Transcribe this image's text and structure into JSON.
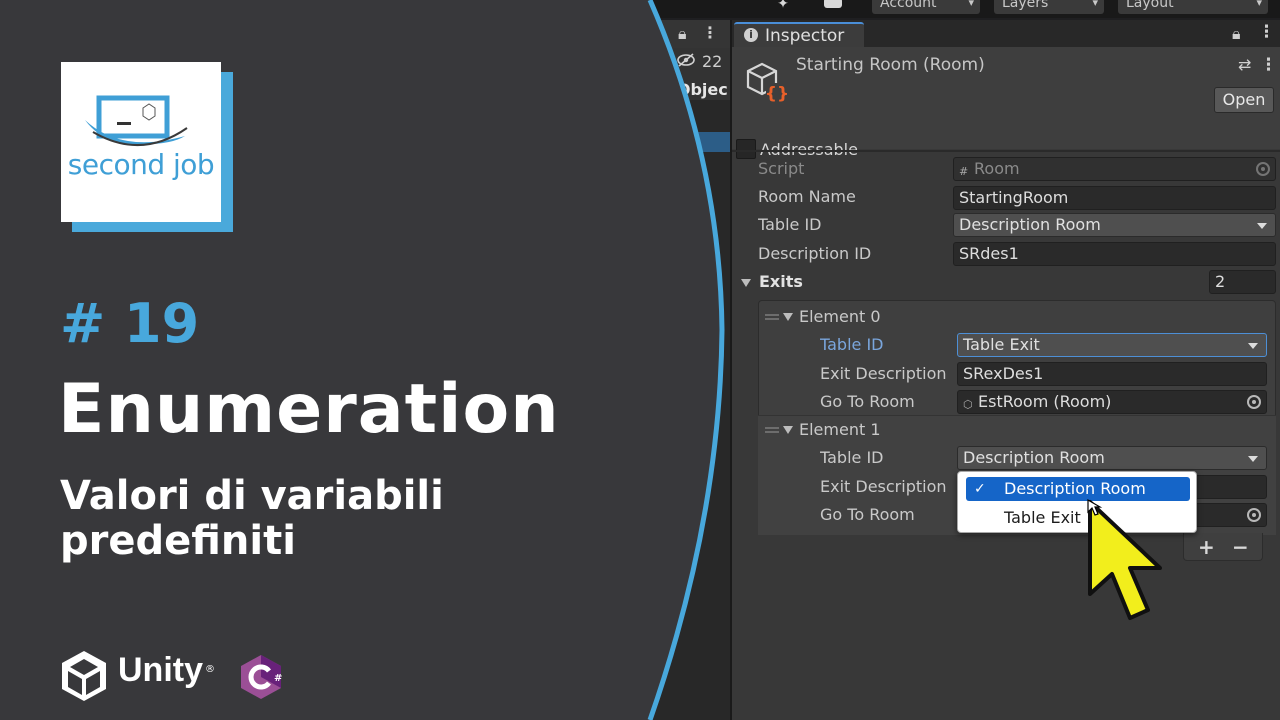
{
  "toolbar": {
    "account_label": "Account",
    "layers_label": "Layers",
    "layout_label": "Layout"
  },
  "hierarchy": {
    "hidden_count": "22",
    "item_label": "eObjec"
  },
  "inspector": {
    "tab_label": "Inspector",
    "asset_title": "Starting Room (Room)",
    "open_label": "Open",
    "addressable_label": "Addressable",
    "fields": {
      "script": {
        "label": "Script",
        "value": "Room"
      },
      "room_name": {
        "label": "Room Name",
        "value": "StartingRoom"
      },
      "table_id": {
        "label": "Table ID",
        "value": "Description Room"
      },
      "description_id": {
        "label": "Description ID",
        "value": "SRdes1"
      }
    },
    "exits": {
      "label": "Exits",
      "size": "2",
      "elements": [
        {
          "header": "Element 0",
          "table_id_label": "Table ID",
          "table_id_value": "Table Exit",
          "exit_desc_label": "Exit Description I",
          "exit_desc_value": "SRexDes1",
          "goto_label": "Go To Room",
          "goto_value": "EstRoom (Room)"
        },
        {
          "header": "Element 1",
          "table_id_label": "Table ID",
          "table_id_value": "Description Room",
          "exit_desc_label": "Exit Description I",
          "goto_label": "Go To Room"
        }
      ],
      "add_label": "+",
      "remove_label": "−"
    },
    "popup": {
      "options": [
        "Description Room",
        "Table Exit"
      ],
      "selected": "Description Room"
    }
  },
  "card": {
    "logo_text": "second job",
    "episode": "# 19",
    "title": "Enumeration",
    "subtitle": "Valori di variabili predefiniti",
    "unity_word": "Unity",
    "colors": {
      "accent": "#48a8dc",
      "background": "#38383b"
    }
  }
}
